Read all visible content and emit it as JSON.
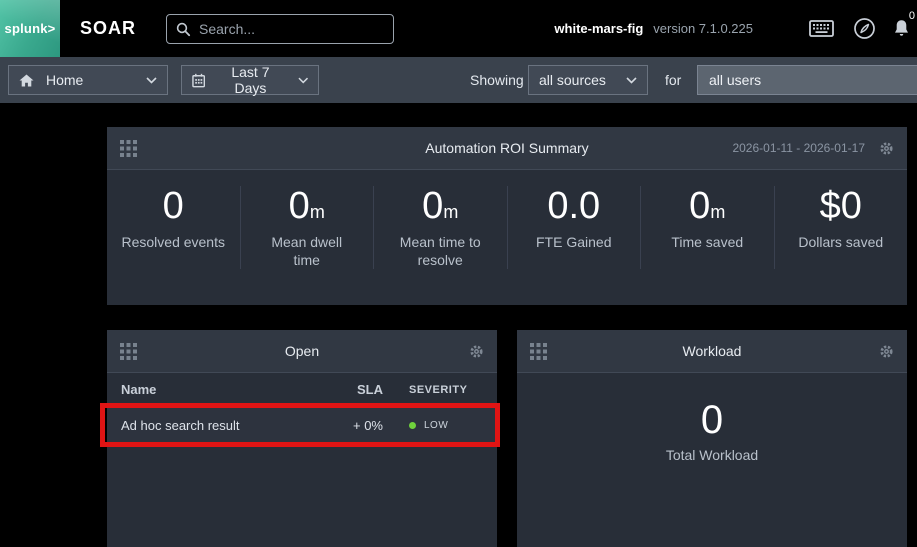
{
  "topbar": {
    "logo_text": "splunk>",
    "product": "SOAR",
    "search_placeholder": "Search...",
    "instance_name": "white-mars-fig",
    "version": "version 7.1.0.225",
    "notification_count": "0"
  },
  "navbar": {
    "home_label": "Home",
    "time_range_label": "Last 7 Days",
    "showing_label": "Showing",
    "sources_value": "all sources",
    "for_label": "for",
    "users_value": "all users"
  },
  "roi_panel": {
    "title": "Automation ROI Summary",
    "date_range": "2026-01-11 - 2026-01-17",
    "stats": [
      {
        "value": "0",
        "unit": "",
        "label": "Resolved events"
      },
      {
        "value": "0",
        "unit": "m",
        "label": "Mean dwell\ntime"
      },
      {
        "value": "0",
        "unit": "m",
        "label": "Mean time to\nresolve"
      },
      {
        "value": "0.0",
        "unit": "",
        "label": "FTE Gained"
      },
      {
        "value": "0",
        "unit": "m",
        "label": "Time saved"
      },
      {
        "value": "$0",
        "unit": "",
        "label": "Dollars saved"
      }
    ]
  },
  "open_panel": {
    "title": "Open",
    "columns": {
      "name": "Name",
      "sla": "SLA",
      "severity": "SEVERITY"
    },
    "rows": [
      {
        "name": "Ad hoc search result",
        "sla": "+ 0%",
        "severity": "LOW"
      }
    ]
  },
  "workload_panel": {
    "title": "Workload",
    "value": "0",
    "label": "Total Workload"
  },
  "colors": {
    "brand_teal": "#3aa98e",
    "severity_low": "#6fd13c",
    "annotation_red": "#e01414",
    "panel_body": "#282e38",
    "panel_header": "#313843",
    "navbar": "#3a424d"
  }
}
